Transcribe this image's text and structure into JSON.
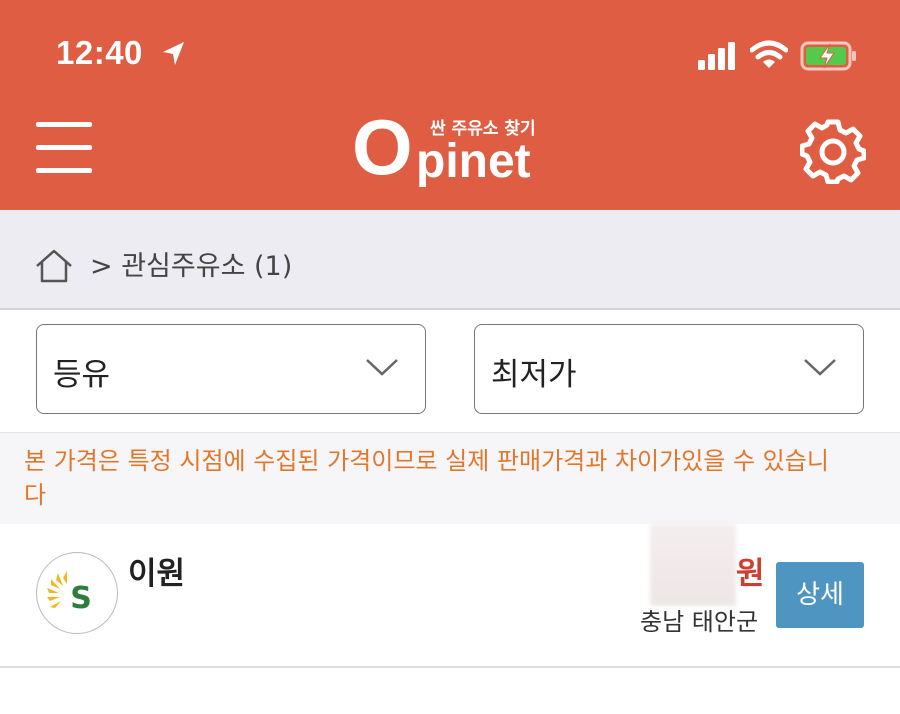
{
  "status_bar": {
    "time": "12:40"
  },
  "header": {
    "logo_o": "O",
    "logo_rest": "pinet",
    "logo_tagline": "싼 주유소 찾기"
  },
  "breadcrumb": {
    "text": "> 관심주유소 (1)"
  },
  "filters": {
    "fuel_type": "등유",
    "sort_order": "최저가"
  },
  "notice": "본 가격은 특정 시점에 수집된 가격이므로 실제 판매가격과 차이가있을 수 있습니다",
  "stations": [
    {
      "name": "이원",
      "price_unit": "원",
      "region": "충남 태안군",
      "detail_label": "상세"
    }
  ],
  "colors": {
    "header_bg": "#DF5D42",
    "notice_text": "#E2772B",
    "price_text": "#D03E30",
    "detail_button": "#4E96C1"
  },
  "icons": [
    "location-arrow-icon",
    "signal-icon",
    "wifi-icon",
    "battery-charging-icon",
    "menu-icon",
    "gear-icon",
    "home-icon",
    "chevron-down-icon",
    "brand-logo-icon"
  ]
}
